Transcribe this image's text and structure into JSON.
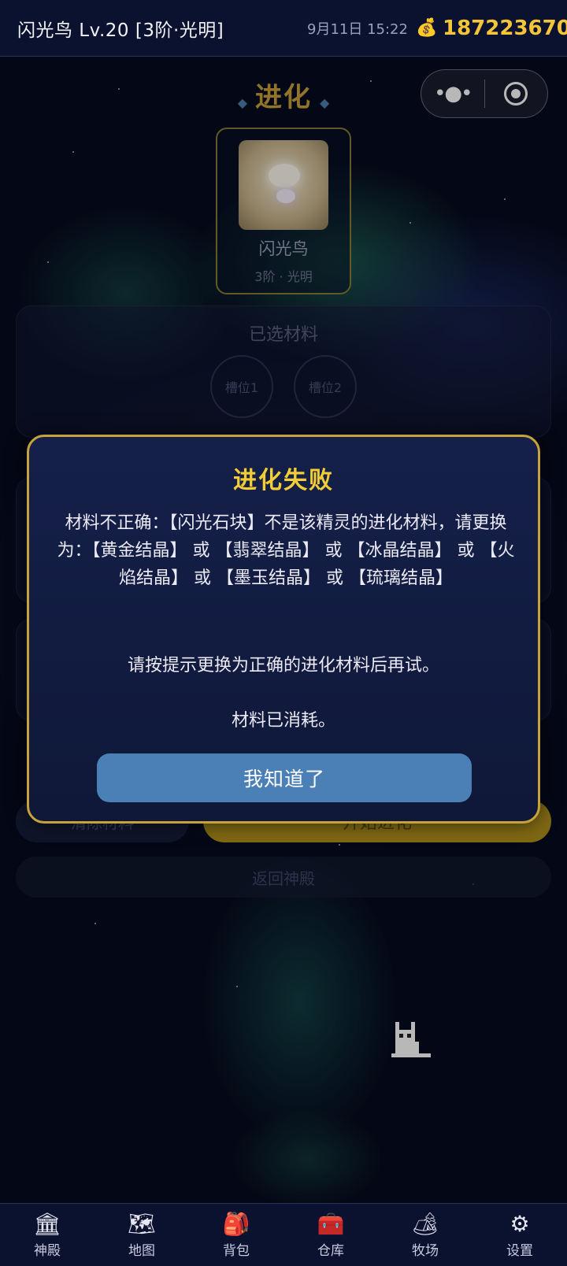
{
  "status_bar": {
    "title": "闪光鸟 Lv.20 [3阶·光明]",
    "date": "9月11日 15:22",
    "money_icon": "money-bag-icon",
    "money": "187223670"
  },
  "header": {
    "title": "进化"
  },
  "capsule": {
    "more_icon": "more-dots-icon",
    "close_icon": "target-circle-icon"
  },
  "pet": {
    "name": "闪光鸟",
    "tier": "3阶 · 光明"
  },
  "materials": {
    "title": "已选材料",
    "slots": [
      "槽位1",
      "槽位2"
    ]
  },
  "actions": {
    "clear_label": "清除材料",
    "start_label": "开始进化",
    "back_label": "返回神殿"
  },
  "dialog": {
    "title": "进化失败",
    "message": "材料不正确：【闪光石块】不是该精灵的进化材料，请更换为：【黄金结晶】 或 【翡翠结晶】 或 【冰晶结晶】 或 【火焰结晶】 或 【墨玉结晶】 或 【琉璃结晶】",
    "hint": "请按提示更换为正确的进化材料后再试。",
    "consumed": "材料已消耗。",
    "button_label": "我知道了",
    "accent_color": "#f3cd35",
    "button_color": "#4a80b6"
  },
  "nav": {
    "items": [
      {
        "label": "神殿",
        "icon": "🏛"
      },
      {
        "label": "地图",
        "icon": "🗺"
      },
      {
        "label": "背包",
        "icon": "🎒"
      },
      {
        "label": "仓库",
        "icon": "🧰"
      },
      {
        "label": "牧场",
        "icon": "🏕"
      },
      {
        "label": "设置",
        "icon": "⚙"
      }
    ]
  }
}
